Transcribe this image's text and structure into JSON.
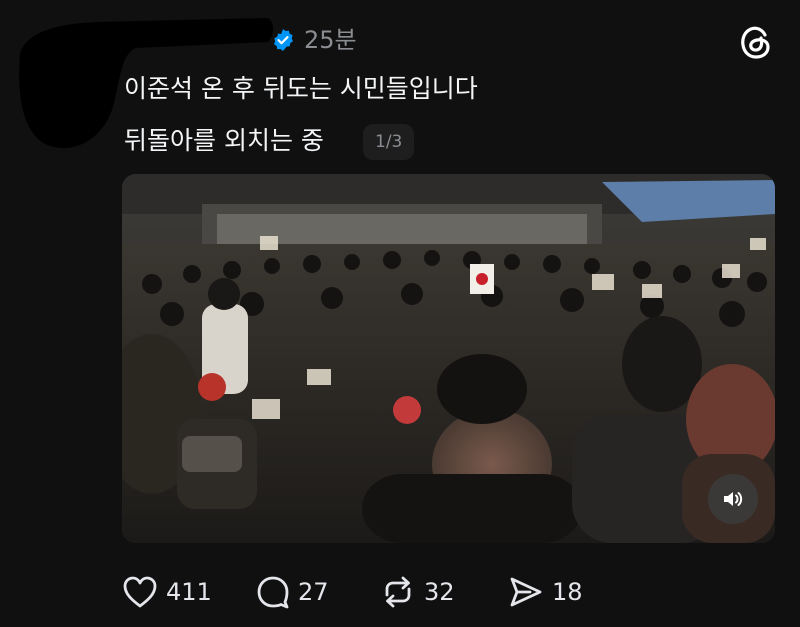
{
  "post": {
    "time": "25분",
    "text_line1": "이준석 온 후 뒤도는 시민들입니다",
    "text_line2": "뒤돌아를 외치는 중",
    "media_counter": "1/3"
  },
  "actions": {
    "likes": "411",
    "replies": "27",
    "reposts": "32",
    "shares": "18"
  },
  "icons": {
    "verified": "verified-badge-icon",
    "app": "threads-logo-icon",
    "sound": "speaker-icon",
    "like": "heart-icon",
    "reply": "comment-icon",
    "repost": "repost-icon",
    "share": "send-icon"
  },
  "colors": {
    "background": "#101010",
    "text": "#f3f5f7",
    "muted": "#8a8d91",
    "verified": "#0095f6"
  }
}
